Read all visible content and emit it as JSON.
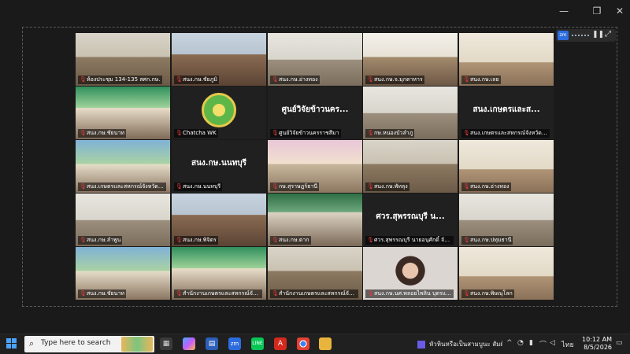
{
  "window": {
    "minimize": "—",
    "restore": "❐",
    "close": "✕"
  },
  "zoom_controls": {
    "logo": "zm",
    "pause_icon": "❚❚",
    "expand_icon": "⤢"
  },
  "participants": [
    {
      "name": "ห้องประชุม 134-135 สศก.กษ.",
      "active": true
    },
    {
      "name": "สนง.กษ.ชัยภูมิ"
    },
    {
      "name": "สนง.กษ.อ่างทอง"
    },
    {
      "name": "สนง.กษ.จ.มุกดาหาร"
    },
    {
      "name": "สนง.กษ.เลย"
    },
    {
      "name": "สนง.กษ.ชัยนาท"
    },
    {
      "name": "Chatcha WK"
    },
    {
      "name": "ศูนย์วิจัยข้าวนครราชสีมา",
      "big": "ศูนย์วิจัยข้าวนคร..."
    },
    {
      "name": "กษ.หนองบัวลำภู"
    },
    {
      "name": "สนง.เกษตรและสหกรณ์จังหวัดนครปฐม",
      "big": "สนง.เกษตรและส..."
    },
    {
      "name": "สนง.เกษตรและสหกรณ์จังหวัดสมุทรสาคร"
    },
    {
      "name": "สนง.กษ.นนทบุรี",
      "big": "สนง.กษ.นนทบุรี"
    },
    {
      "name": "กษ.สุราษฎร์ธานี"
    },
    {
      "name": "สนง.กษ.พัทลุง"
    },
    {
      "name": "สนง.กษ.อ่างทอง"
    },
    {
      "name": "สนง.กษ.ลำพูน"
    },
    {
      "name": "สนง.กษ.พิจิตร"
    },
    {
      "name": "สนง.กษ.ตาก"
    },
    {
      "name": "ศวร.สุพรรณบุรี นายอนุศักดิ์ จันทร์แก้ว",
      "big": "ศวร.สุพรรณบุรี น..."
    },
    {
      "name": "สนง.กษ.ปทุมธานี"
    },
    {
      "name": "สนง.กษ.ชัยนาท"
    },
    {
      "name": "สำนักงานเกษตรและสหกรณ์จังหวัดยโสธร"
    },
    {
      "name": "สำนักงานเกษตรและสหกรณ์จังหวัดลำปาง"
    },
    {
      "name": "สนง.กษ.นศ.พลอยไพลิน บุตรแสงดี"
    },
    {
      "name": "สนง.กษ.พิษณุโลก"
    }
  ],
  "taskbar": {
    "search_placeholder": "Type here to search",
    "media_title": "หัวหินหรือเป็นสามบูนะ สัมผัส...",
    "lang": "ไทย",
    "time": "10:12 AM",
    "date": "8/5/2026"
  }
}
